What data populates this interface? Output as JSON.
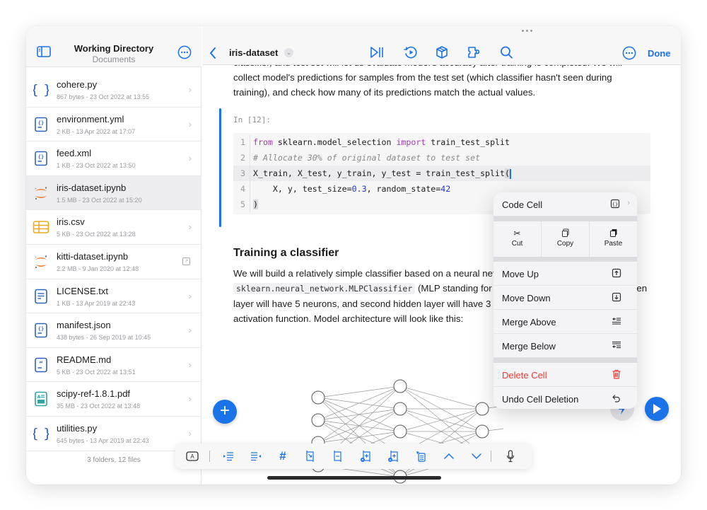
{
  "sidebar": {
    "title": "Working Directory",
    "subtitle": "Documents",
    "files": [
      {
        "name": "cohere.py",
        "meta": "867 bytes - 23 Oct 2022 at 13:55",
        "icon": "python-braces-icon",
        "accessory": "chevron"
      },
      {
        "name": "environment.yml",
        "meta": "2 KB - 13 Apr 2022 at 17:07",
        "icon": "config-file-icon",
        "accessory": "chevron"
      },
      {
        "name": "feed.xml",
        "meta": "1 KB - 23 Oct 2022 at 13:50",
        "icon": "config-file-icon",
        "accessory": "chevron"
      },
      {
        "name": "iris-dataset.ipynb",
        "meta": "1.5 MB - 23 Oct 2022 at 15:20",
        "icon": "jupyter-icon",
        "accessory": "none",
        "selected": true
      },
      {
        "name": "iris.csv",
        "meta": "5 KB - 23 Oct 2022 at 13:28",
        "icon": "table-icon",
        "accessory": "chevron"
      },
      {
        "name": "kitti-dataset.ipynb",
        "meta": "2.2 MB - 9 Jan 2020 at 12:48",
        "icon": "jupyter-icon",
        "accessory": "external"
      },
      {
        "name": "LICENSE.txt",
        "meta": "1 KB - 13 Apr 2019 at 22:43",
        "icon": "text-file-icon",
        "accessory": "chevron"
      },
      {
        "name": "manifest.json",
        "meta": "438 bytes - 26 Sep 2019 at 10:45",
        "icon": "config-file-icon",
        "accessory": "chevron"
      },
      {
        "name": "README.md",
        "meta": "5 KB - 23 Oct 2022 at 13:51",
        "icon": "markdown-file-icon",
        "accessory": "chevron"
      },
      {
        "name": "scipy-ref-1.8.1.pdf",
        "meta": "35 MB - 23 Oct 2022 at 13:48",
        "icon": "pdf-file-icon",
        "accessory": "chevron"
      },
      {
        "name": "utilities.py",
        "meta": "645 bytes - 13 Apr 2019 at 22:43",
        "icon": "python-braces-icon",
        "accessory": "chevron"
      }
    ],
    "footer": "3 folders, 12 files"
  },
  "topbar": {
    "notebook_title": "iris-dataset",
    "done_label": "Done",
    "icons": [
      "run-all-icon",
      "restart-kernel-icon",
      "packages-icon",
      "extensions-icon",
      "search-icon"
    ]
  },
  "content": {
    "para1_cut": "classifier, and test set will let us evaluate model's accuracy after training is completed. We will",
    "para1_l2": "collect model's predictions for samples from the test set (which classifier hasn't seen during",
    "para1_l3": "training), and check how many of its predictions match the actual values.",
    "cell_label": "In [12]:",
    "code": {
      "line1": {
        "kw1": "from",
        "mid": " sklearn.model_selection ",
        "kw2": "import",
        "rest": " train_test_split"
      },
      "line2": "# Allocate 30% of original dataset to test set",
      "line3": "X_train, X_test, y_train, y_test = train_test_split",
      "line3_paren": "(",
      "line4_a": "    X, y, test_size=",
      "line4_n1": "0.3",
      "line4_b": ", random_state=",
      "line4_n2": "42",
      "line5": ")"
    },
    "heading": "Training a classifier",
    "para2_a": "We will build a relatively simple classifier based on a neural network, using",
    "para2_code": "sklearn.neural_network.MLPClassifier",
    "para2_b": " (MLP standing for Multi-Layer Perceptron). First hidden",
    "para2_c": "layer will have 5 neurons, and second hidden layer will have 3 neurons, each using ReLU",
    "para2_d": "activation function. Model architecture will look like this:",
    "diagram_layers": [
      4,
      5,
      3
    ]
  },
  "context_menu": {
    "header": "Code Cell",
    "actions": [
      {
        "label": "Cut",
        "glyph": "✂"
      },
      {
        "label": "Copy",
        "glyph": "⎘"
      },
      {
        "label": "Paste",
        "glyph": "📋"
      }
    ],
    "items": [
      {
        "label": "Move Up",
        "icon": "move-up-icon"
      },
      {
        "label": "Move Down",
        "icon": "move-down-icon"
      },
      {
        "label": "Merge Above",
        "icon": "merge-above-icon"
      },
      {
        "label": "Merge Below",
        "icon": "merge-below-icon"
      }
    ],
    "delete_label": "Delete Cell",
    "undo_label": "Undo Cell Deletion"
  },
  "keyboard_toolbar": {
    "items": [
      "cell-type-icon",
      "indent-icon",
      "outdent-icon",
      "comment-icon",
      "split-cell-icon",
      "merge-cell-icon",
      "insert-above-icon",
      "insert-below-icon",
      "convert-cell-icon",
      "move-up-chevron-icon",
      "move-down-chevron-icon",
      "microphone-icon"
    ],
    "cell_type_label": "A"
  },
  "colors": {
    "accent": "#1a73e8",
    "danger": "#ec3b33",
    "jupyter_orange": "#f37726",
    "csv_yellow": "#f0a820",
    "pdf_teal": "#2ea6a6"
  }
}
